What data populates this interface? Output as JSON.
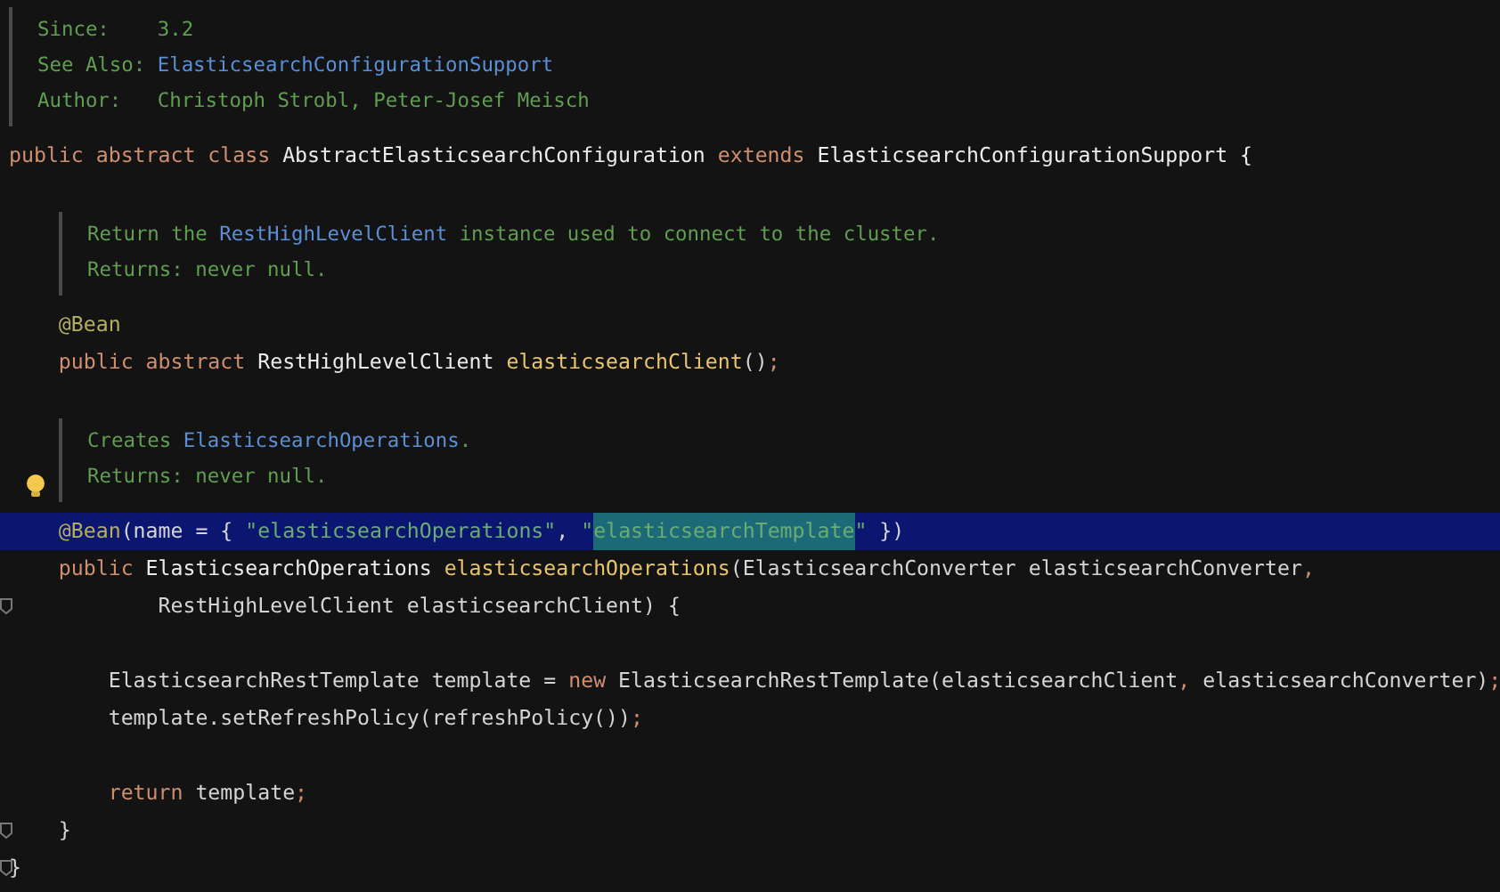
{
  "lines": [
    {
      "kind": "doc",
      "indented": false,
      "rows": [
        [
          {
            "kind": "label",
            "text": "Since:"
          },
          {
            "kind": "text",
            "text": "3.2"
          }
        ],
        [
          {
            "kind": "label",
            "text": "See Also:"
          },
          {
            "kind": "link",
            "text": "ElasticsearchConfigurationSupport"
          }
        ],
        [
          {
            "kind": "label",
            "text": "Author:"
          },
          {
            "kind": "text",
            "text": "Christoph Strobl, Peter-Josef Meisch"
          }
        ]
      ]
    },
    {
      "kind": "code",
      "highlighted": false,
      "tokens": [
        {
          "kind": "keyword",
          "text": "public abstract class "
        },
        {
          "kind": "type",
          "text": "AbstractElasticsearchConfiguration "
        },
        {
          "kind": "keyword",
          "text": "extends "
        },
        {
          "kind": "type",
          "text": "ElasticsearchConfigurationSupport {"
        }
      ]
    },
    {
      "kind": "blank"
    },
    {
      "kind": "doc",
      "indented": true,
      "rows": [
        [
          {
            "kind": "text",
            "text": "Return the "
          },
          {
            "kind": "link",
            "text": "RestHighLevelClient"
          },
          {
            "kind": "text",
            "text": " instance used to connect to the cluster."
          }
        ],
        [
          {
            "kind": "label",
            "text": "Returns:"
          },
          {
            "kind": "text",
            "text": "never null."
          }
        ]
      ]
    },
    {
      "kind": "code",
      "highlighted": false,
      "tokens": [
        {
          "kind": "annotation",
          "text": "    @Bean"
        }
      ]
    },
    {
      "kind": "code",
      "highlighted": false,
      "tokens": [
        {
          "kind": "keyword",
          "text": "    public abstract "
        },
        {
          "kind": "type",
          "text": "RestHighLevelClient "
        },
        {
          "kind": "method",
          "text": "elasticsearchClient"
        },
        {
          "kind": "plain",
          "text": "()"
        },
        {
          "kind": "keyword",
          "text": ";"
        }
      ]
    },
    {
      "kind": "blank"
    },
    {
      "kind": "doc",
      "indented": true,
      "lightbulb": true,
      "rows": [
        [
          {
            "kind": "text",
            "text": "Creates "
          },
          {
            "kind": "link",
            "text": "ElasticsearchOperations"
          },
          {
            "kind": "text",
            "text": "."
          }
        ],
        [
          {
            "kind": "label",
            "text": "Returns:"
          },
          {
            "kind": "text",
            "text": "never null."
          }
        ]
      ]
    },
    {
      "kind": "code",
      "highlighted": true,
      "tokens": [
        {
          "kind": "annotation",
          "text": "    @Bean"
        },
        {
          "kind": "plain",
          "text": "(name = { "
        },
        {
          "kind": "string",
          "text": "\"elasticsearchOperations\""
        },
        {
          "kind": "plain",
          "text": ", "
        },
        {
          "kind": "string",
          "text": "\""
        },
        {
          "kind": "string",
          "text": "elasticsearchTemplate",
          "selected": true
        },
        {
          "kind": "string",
          "text": "\""
        },
        {
          "kind": "plain",
          "text": " })"
        }
      ]
    },
    {
      "kind": "code",
      "highlighted": false,
      "tokens": [
        {
          "kind": "keyword",
          "text": "    public "
        },
        {
          "kind": "type",
          "text": "ElasticsearchOperations "
        },
        {
          "kind": "method",
          "text": "elasticsearchOperations"
        },
        {
          "kind": "plain",
          "text": "(ElasticsearchConverter elasticsearchConverter"
        },
        {
          "kind": "keyword",
          "text": ","
        }
      ]
    },
    {
      "kind": "code",
      "highlighted": false,
      "fold_marker": true,
      "tokens": [
        {
          "kind": "plain",
          "text": "            RestHighLevelClient elasticsearchClient) {"
        }
      ]
    },
    {
      "kind": "blank"
    },
    {
      "kind": "code",
      "highlighted": false,
      "tokens": [
        {
          "kind": "plain",
          "text": "        ElasticsearchRestTemplate template = "
        },
        {
          "kind": "keyword",
          "text": "new "
        },
        {
          "kind": "plain",
          "text": "ElasticsearchRestTemplate(elasticsearchClient"
        },
        {
          "kind": "keyword",
          "text": ", "
        },
        {
          "kind": "plain",
          "text": "elasticsearchConverter)"
        },
        {
          "kind": "keyword",
          "text": ";"
        }
      ]
    },
    {
      "kind": "code",
      "highlighted": false,
      "tokens": [
        {
          "kind": "plain",
          "text": "        template.setRefreshPolicy(refreshPolicy())"
        },
        {
          "kind": "keyword",
          "text": ";"
        }
      ]
    },
    {
      "kind": "blank"
    },
    {
      "kind": "code",
      "highlighted": false,
      "tokens": [
        {
          "kind": "keyword",
          "text": "        return "
        },
        {
          "kind": "plain",
          "text": "template"
        },
        {
          "kind": "keyword",
          "text": ";"
        }
      ]
    },
    {
      "kind": "code",
      "highlighted": false,
      "fold_marker": true,
      "tokens": [
        {
          "kind": "plain",
          "text": "    }"
        }
      ]
    },
    {
      "kind": "code",
      "highlighted": false,
      "fold_marker": true,
      "tokens": [
        {
          "kind": "plain",
          "text": "}"
        }
      ]
    }
  ]
}
